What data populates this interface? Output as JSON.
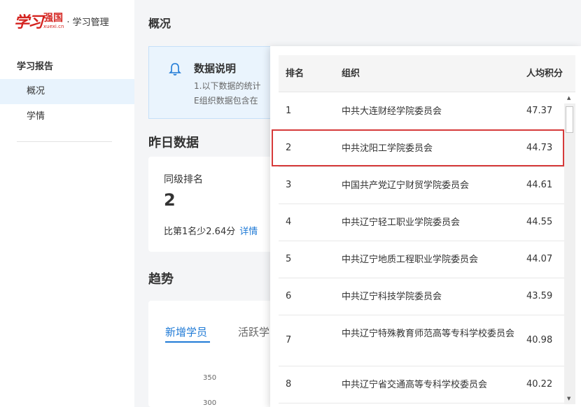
{
  "brand": {
    "logo_text": "学习",
    "logo_red": "强国",
    "logo_url": "xuexi.cn",
    "suffix": "· 学习管理"
  },
  "sidebar": {
    "group": "学习报告",
    "items": [
      {
        "label": "概况",
        "active": true
      },
      {
        "label": "学情",
        "active": false
      }
    ]
  },
  "page_title": "概况",
  "notice": {
    "title": "数据说明",
    "line1": "1.以下数据的统计",
    "line2": "E组织数据包含在"
  },
  "yesterday": {
    "title": "昨日数据",
    "rank_label": "同级排名",
    "rank_value": "2",
    "diff": "比第1名少2.64分",
    "detail": "详情"
  },
  "trend": {
    "title": "趋势",
    "tabs": [
      "新增学员",
      "活跃学"
    ],
    "ticks": [
      "350",
      "300"
    ]
  },
  "rank_table": {
    "columns": {
      "rank": "排名",
      "org": "组织",
      "score": "人均积分"
    },
    "rows": [
      {
        "rank": "1",
        "org": "中共大连财经学院委员会",
        "score": "47.37"
      },
      {
        "rank": "2",
        "org": "中共沈阳工学院委员会",
        "score": "44.73"
      },
      {
        "rank": "3",
        "org": "中国共产党辽宁财贸学院委员会",
        "score": "44.61"
      },
      {
        "rank": "4",
        "org": "中共辽宁轻工职业学院委员会",
        "score": "44.55"
      },
      {
        "rank": "5",
        "org": "中共辽宁地质工程职业学院委员会",
        "score": "44.07"
      },
      {
        "rank": "6",
        "org": "中共辽宁科技学院委员会",
        "score": "43.59"
      },
      {
        "rank": "7",
        "org": "中共辽宁特殊教育师范高等专科学校委员会",
        "score": "40.98"
      },
      {
        "rank": "8",
        "org": "中共辽宁省交通高等专科学校委员会",
        "score": "40.22"
      }
    ],
    "highlight_color": "#d63a3a"
  },
  "colors": {
    "accent": "#1f7ad6",
    "brand": "#d4231f"
  }
}
